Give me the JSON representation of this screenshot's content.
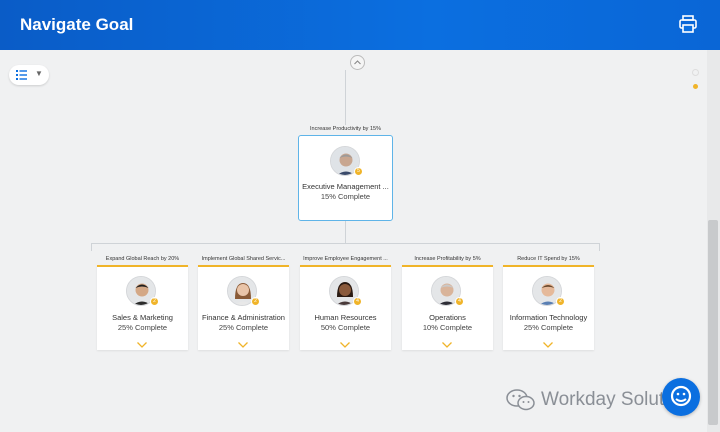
{
  "header": {
    "title": "Navigate Goal"
  },
  "icons": {
    "print": "printer-icon",
    "view": "list-view-icon",
    "collapse": "chevron-up-icon",
    "expand": "chevron-down-icon"
  },
  "colors": {
    "header": "#0b6fe0",
    "accent": "#f0b429",
    "root_border": "#5fb4e8"
  },
  "root": {
    "goal": "Increase Productivity by 15%",
    "name": "Executive Management ...",
    "progress": "15% Complete",
    "badge": "5"
  },
  "children": [
    {
      "goal": "Expand Global Reach by 20%",
      "name": "Sales & Marketing",
      "progress": "25% Complete",
      "badge": "2"
    },
    {
      "goal": "Implement Global Shared Servic...",
      "name": "Finance & Administration",
      "progress": "25% Complete",
      "badge": "2"
    },
    {
      "goal": "Improve Employee Engagement ...",
      "name": "Human Resources",
      "progress": "50% Complete",
      "badge": "4"
    },
    {
      "goal": "Increase Profitability by 5%",
      "name": "Operations",
      "progress": "10% Complete",
      "badge": "4"
    },
    {
      "goal": "Reduce IT Spend by 15%",
      "name": "Information Technology",
      "progress": "25% Complete",
      "badge": "2"
    }
  ],
  "watermark": {
    "text": "Workday Solutions"
  }
}
